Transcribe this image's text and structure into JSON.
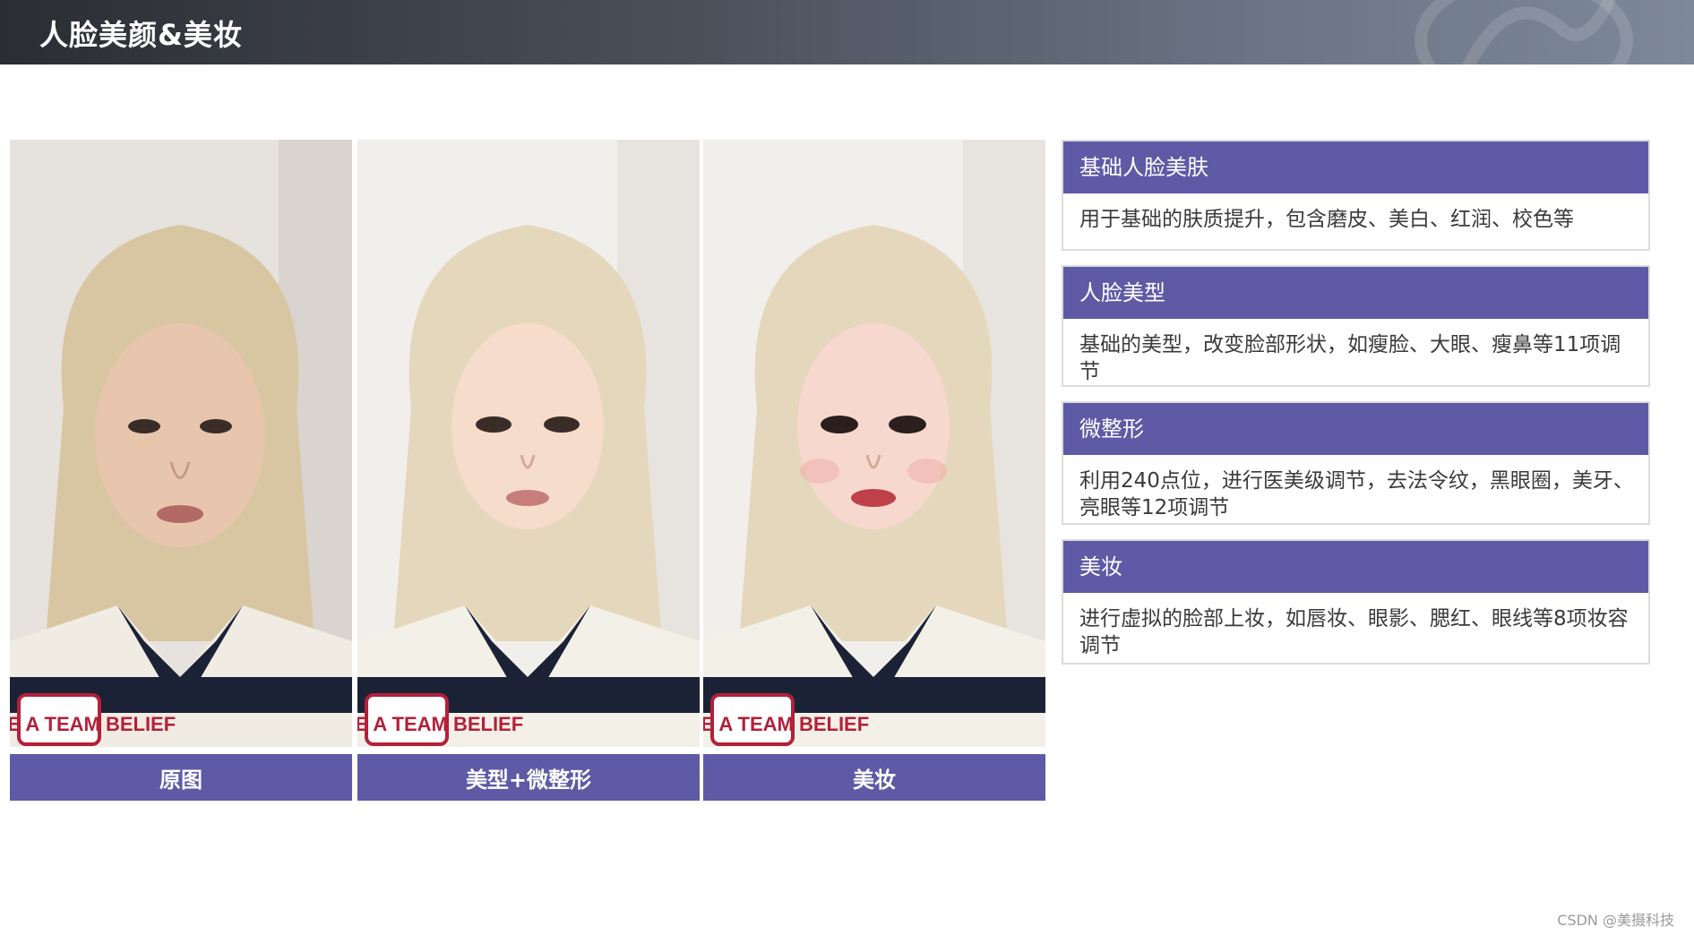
{
  "header": {
    "title": "人脸美颜&美妆",
    "accent": "#2b2d33"
  },
  "photos": [
    {
      "caption": "原图",
      "shirt_logo": "WE ARE A TEAM BELIEF"
    },
    {
      "caption": "美型+微整形",
      "shirt_logo": "WE ARE A TEAM BELIEF"
    },
    {
      "caption": "美妆",
      "shirt_logo": "WE ARE A TEAM BELIEF"
    }
  ],
  "features": [
    {
      "title": "基础人脸美肤",
      "desc": "用于基础的肤质提升，包含磨皮、美白、红润、校色等"
    },
    {
      "title": "人脸美型",
      "desc": "基础的美型，改变脸部形状，如瘦脸、大眼、瘦鼻等11项调节"
    },
    {
      "title": "微整形",
      "desc": "利用240点位，进行医美级调节，去法令纹，黑眼圈，美牙、亮眼等12项调节"
    },
    {
      "title": "美妆",
      "desc": "进行虚拟的脸部上妆，如唇妆、眼影、腮红、眼线等8项妆容调节"
    }
  ],
  "colors": {
    "brand": "#5e5aa6"
  },
  "watermark": "CSDN @美摄科技"
}
